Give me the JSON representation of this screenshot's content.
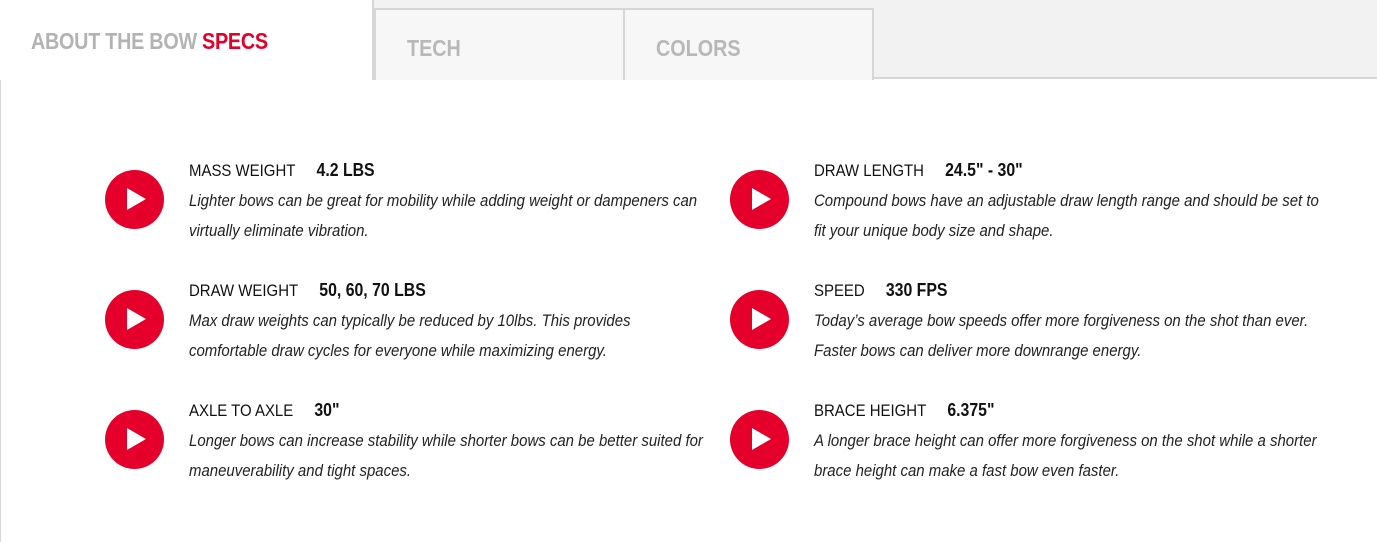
{
  "tabs": {
    "active_primary": "ABOUT THE BOW",
    "active_secondary": "SPECS",
    "tech": "TECH",
    "colors": "COLORS"
  },
  "colors": {
    "accent": "#e4002b",
    "tab_text": "#b3b3b3",
    "border": "#d6d6d6"
  },
  "specs": [
    {
      "name": "MASS WEIGHT",
      "value": "4.2 LBS",
      "description": "Lighter bows can be great for mobility while adding weight or dampeners can virtually eliminate vibration.",
      "icon": "play-icon"
    },
    {
      "name": "DRAW LENGTH",
      "value": "24.5\" - 30\"",
      "description": "Compound bows have an adjustable draw length range and should be set to fit your unique body size and shape.",
      "icon": "play-icon"
    },
    {
      "name": "DRAW WEIGHT",
      "value": "50, 60, 70 LBS",
      "description": "Max draw weights can typically be reduced by 10lbs. This provides comfortable draw cycles for everyone while maximizing energy.",
      "icon": "play-icon"
    },
    {
      "name": "SPEED",
      "value": "330 FPS",
      "description": "Today’s average bow speeds offer more forgiveness on the shot than ever. Faster bows can deliver more downrange energy.",
      "icon": "play-icon"
    },
    {
      "name": "AXLE TO AXLE",
      "value": "30\"",
      "description": "Longer bows can increase stability while shorter bows can be better suited for maneuverability and tight spaces.",
      "icon": "play-icon"
    },
    {
      "name": "BRACE HEIGHT",
      "value": "6.375\"",
      "description": "A longer brace height can offer more forgiveness on the shot while a shorter brace height can make a fast bow even faster.",
      "icon": "play-icon"
    }
  ]
}
